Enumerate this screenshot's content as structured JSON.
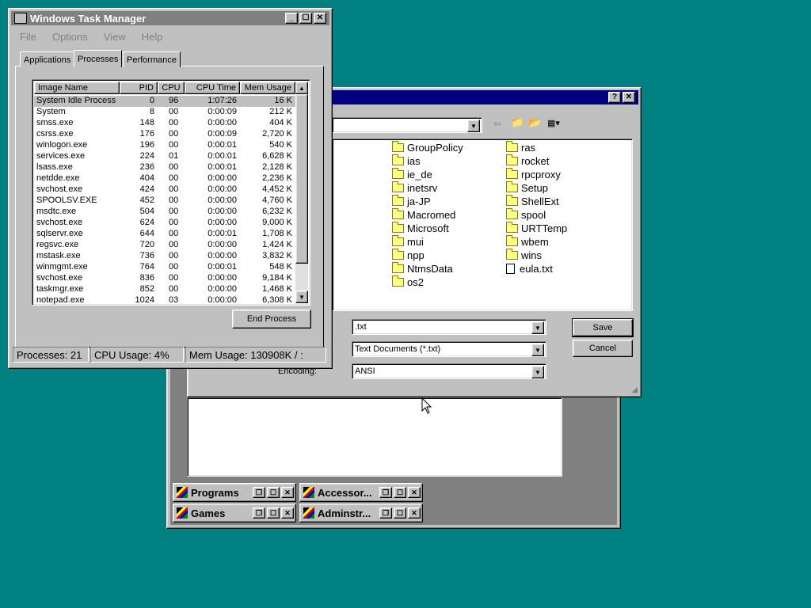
{
  "task_manager": {
    "title": "Windows Task Manager",
    "menu": [
      "File",
      "Options",
      "View",
      "Help"
    ],
    "tabs": [
      "Applications",
      "Processes",
      "Performance"
    ],
    "active_tab": "Processes",
    "columns": [
      "Image Name",
      "PID",
      "CPU",
      "CPU Time",
      "Mem Usage"
    ],
    "processes": [
      {
        "name": "System Idle Process",
        "pid": "0",
        "cpu": "96",
        "time": "1:07:26",
        "mem": "16 K"
      },
      {
        "name": "System",
        "pid": "8",
        "cpu": "00",
        "time": "0:00:09",
        "mem": "212 K"
      },
      {
        "name": "smss.exe",
        "pid": "148",
        "cpu": "00",
        "time": "0:00:00",
        "mem": "404 K"
      },
      {
        "name": "csrss.exe",
        "pid": "176",
        "cpu": "00",
        "time": "0:00:09",
        "mem": "2,720 K"
      },
      {
        "name": "winlogon.exe",
        "pid": "196",
        "cpu": "00",
        "time": "0:00:01",
        "mem": "540 K"
      },
      {
        "name": "services.exe",
        "pid": "224",
        "cpu": "01",
        "time": "0:00:01",
        "mem": "6,628 K"
      },
      {
        "name": "lsass.exe",
        "pid": "236",
        "cpu": "00",
        "time": "0:00:01",
        "mem": "2,128 K"
      },
      {
        "name": "netdde.exe",
        "pid": "404",
        "cpu": "00",
        "time": "0:00:00",
        "mem": "2,236 K"
      },
      {
        "name": "svchost.exe",
        "pid": "424",
        "cpu": "00",
        "time": "0:00:00",
        "mem": "4,452 K"
      },
      {
        "name": "SPOOLSV.EXE",
        "pid": "452",
        "cpu": "00",
        "time": "0:00:00",
        "mem": "4,760 K"
      },
      {
        "name": "msdtc.exe",
        "pid": "504",
        "cpu": "00",
        "time": "0:00:00",
        "mem": "6,232 K"
      },
      {
        "name": "svchost.exe",
        "pid": "624",
        "cpu": "00",
        "time": "0:00:00",
        "mem": "9,000 K"
      },
      {
        "name": "sqlservr.exe",
        "pid": "644",
        "cpu": "00",
        "time": "0:00:01",
        "mem": "1,708 K"
      },
      {
        "name": "regsvc.exe",
        "pid": "720",
        "cpu": "00",
        "time": "0:00:00",
        "mem": "1,424 K"
      },
      {
        "name": "mstask.exe",
        "pid": "736",
        "cpu": "00",
        "time": "0:00:00",
        "mem": "3,832 K"
      },
      {
        "name": "winmgmt.exe",
        "pid": "764",
        "cpu": "00",
        "time": "0:00:01",
        "mem": "548 K"
      },
      {
        "name": "svchost.exe",
        "pid": "836",
        "cpu": "00",
        "time": "0:00:00",
        "mem": "9,184 K"
      },
      {
        "name": "taskmgr.exe",
        "pid": "852",
        "cpu": "00",
        "time": "0:00:00",
        "mem": "1,468 K"
      },
      {
        "name": "notepad.exe",
        "pid": "1024",
        "cpu": "03",
        "time": "0:00:00",
        "mem": "6,308 K"
      }
    ],
    "end_process_label": "End Process",
    "status": {
      "processes": "Processes: 21",
      "cpu": "CPU Usage: 4%",
      "mem": "Mem Usage: 130908K / :"
    }
  },
  "save_dialog": {
    "help_glyph": "?",
    "close_glyph": "✕",
    "folders_col1": [
      "GroupPolicy",
      "ias",
      "ie_de",
      "inetsrv",
      "ja-JP",
      "Macromed",
      "Microsoft",
      "mui",
      "npp",
      "NtmsData",
      "os2"
    ],
    "folders_col2": [
      "ras",
      "rocket",
      "rpcproxy",
      "Setup",
      "ShellExt",
      "spool",
      "URTTemp",
      "wbem",
      "wins"
    ],
    "file_item": "eula.txt",
    "filename_value": ".txt",
    "file_type_value": "Text Documents (*.txt)",
    "encoding_label": "Encoding:",
    "encoding_value": "ANSI",
    "save_label": "Save",
    "cancel_label": "Cancel"
  },
  "minimized_windows": [
    "Programs",
    "Accessor...",
    "Games",
    "Adminstr..."
  ],
  "colors": {
    "desktop": "#008080",
    "active_title": "#000080",
    "inactive_title": "#808080",
    "face": "#c0c0c0"
  }
}
